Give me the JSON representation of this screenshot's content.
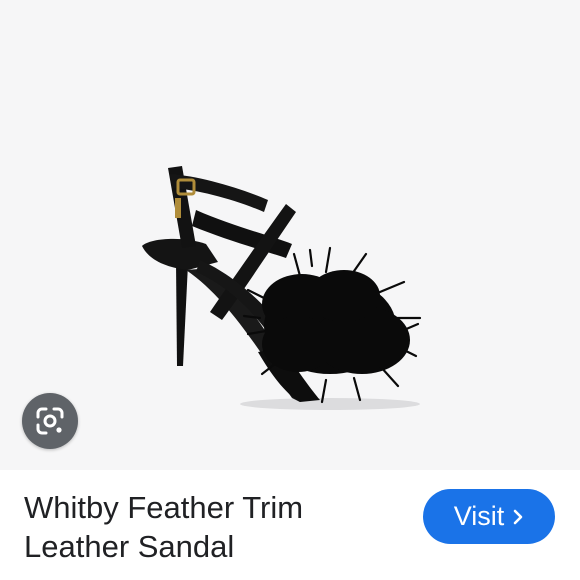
{
  "image": {
    "subject": "black high-heel sandal with feather pom-pom and cross straps",
    "background_color": "#f6f6f7"
  },
  "lens_button": {
    "icon": "google-lens-icon",
    "color": "#5f6368"
  },
  "product": {
    "title_line1": "Whitby Feather Trim",
    "title_line2": "Leather Sandal"
  },
  "visit_button": {
    "label": "Visit",
    "icon": "chevron-right-icon",
    "color": "#1a73e8"
  }
}
